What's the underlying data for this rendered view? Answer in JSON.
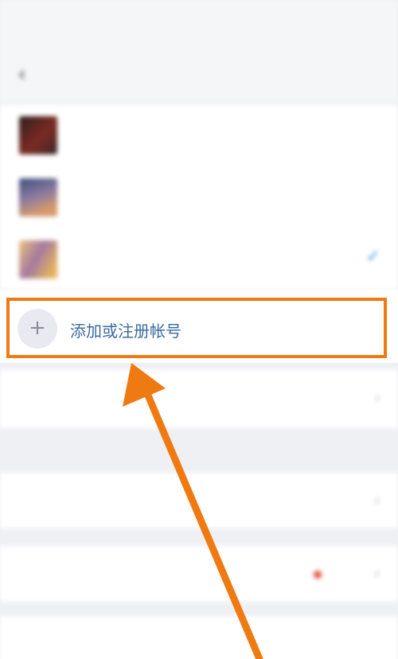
{
  "status_bar": {
    "time": "",
    "icons": ""
  },
  "nav": {
    "back_icon": "chevron-left-icon",
    "title": "",
    "action": ""
  },
  "accounts": [
    {
      "name": "",
      "id": "",
      "emoji": ""
    },
    {
      "name": "",
      "id": "",
      "emoji": ""
    },
    {
      "name": "",
      "id": "",
      "emoji": "",
      "selected": true
    }
  ],
  "add_account": {
    "label": "添加或注册帐号",
    "icon": "plus-icon"
  },
  "menu": [
    {
      "label": "",
      "value": ""
    },
    {
      "note": ""
    },
    {
      "label": "",
      "value": ""
    },
    {
      "label": "",
      "value": "",
      "dot": true
    },
    {
      "label": ""
    }
  ],
  "annotation": {
    "box_color": "#f07a12",
    "arrow_color": "#f07a12"
  },
  "colors": {
    "link": "#3a6aa0",
    "accent": "#3d8fe0",
    "background": "#eff0f4"
  }
}
